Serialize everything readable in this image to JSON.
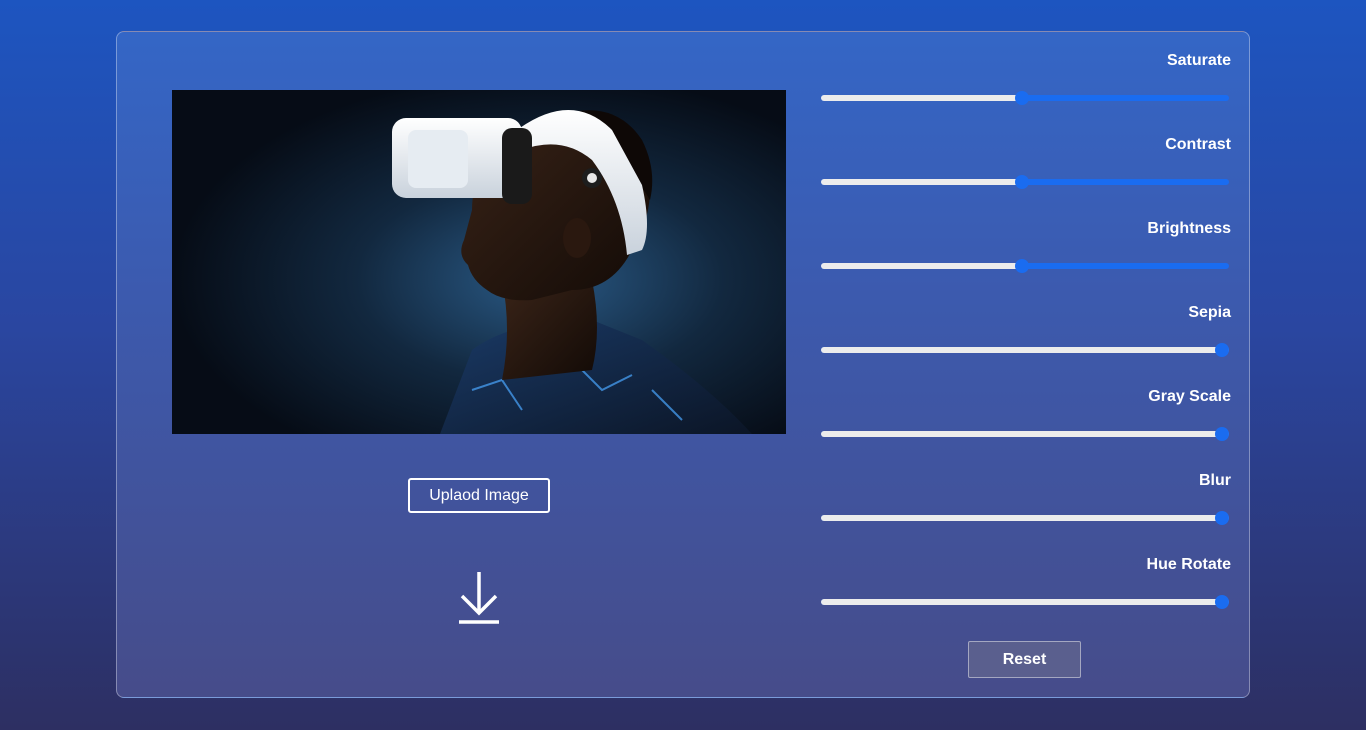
{
  "preview": {
    "image_alt_icon": "vr-headset-photo"
  },
  "upload_button": {
    "label": "Uplaod Image"
  },
  "download_icon": "download-arrow-icon",
  "filters": [
    {
      "label": "Saturate",
      "value": 0.5
    },
    {
      "label": "Contrast",
      "value": 0.5
    },
    {
      "label": "Brightness",
      "value": 0.5
    },
    {
      "label": "Sepia",
      "value": 1.0
    },
    {
      "label": "Gray Scale",
      "value": 1.0
    },
    {
      "label": "Blur",
      "value": 1.0
    },
    {
      "label": "Hue Rotate",
      "value": 1.0
    }
  ],
  "reset_button": {
    "label": "Reset"
  },
  "colors": {
    "accent": "#1a6cf0",
    "track_filled": "#ececec"
  }
}
